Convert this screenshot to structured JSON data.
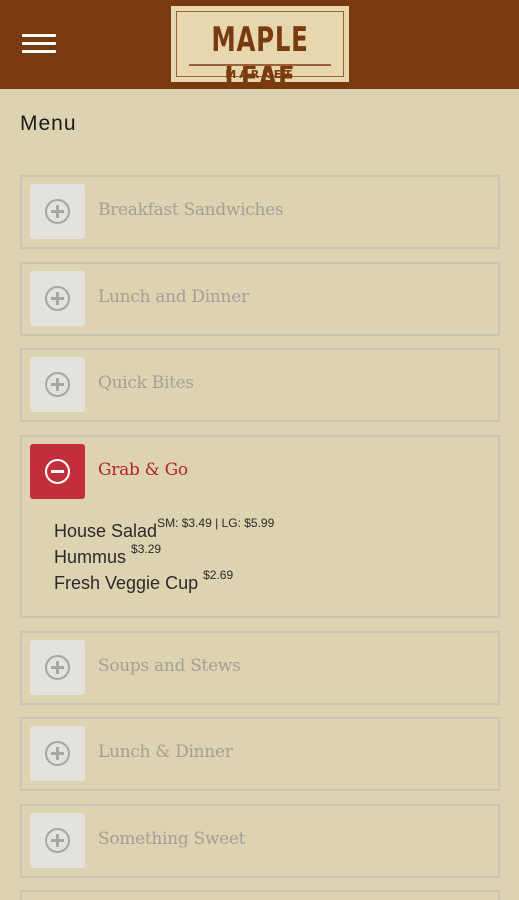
{
  "header": {
    "logo_title": "MAPLE LEAF",
    "logo_subtitle": "MARKET",
    "colors": {
      "bar": "#7a3a10",
      "logo_bg": "#e6d7ae"
    }
  },
  "page": {
    "title": "Menu",
    "background": "#ddd3b1"
  },
  "accordion": [
    {
      "label": "Breakfast Sandwiches",
      "expanded": false,
      "icon": "plus-circle-icon"
    },
    {
      "label": "Lunch and Dinner",
      "expanded": false,
      "icon": "plus-circle-icon"
    },
    {
      "label": "Quick Bites",
      "expanded": false,
      "icon": "plus-circle-icon"
    },
    {
      "label": "Grab & Go",
      "expanded": true,
      "icon": "minus-circle-icon",
      "items": [
        {
          "name": "House Salad",
          "price": "SM: $3.49 | LG: $5.99"
        },
        {
          "name": "Hummus ",
          "price": "$3.29"
        },
        {
          "name": "Fresh Veggie Cup ",
          "price": "$2.69"
        }
      ]
    },
    {
      "label": "Soups and Stews",
      "expanded": false,
      "icon": "plus-circle-icon"
    },
    {
      "label": "Lunch & Dinner",
      "expanded": false,
      "icon": "plus-circle-icon"
    },
    {
      "label": "Something Sweet",
      "expanded": false,
      "icon": "plus-circle-icon"
    },
    {
      "label": "",
      "expanded": false,
      "icon": "plus-circle-icon"
    }
  ],
  "accent_color": "#c22f3b"
}
